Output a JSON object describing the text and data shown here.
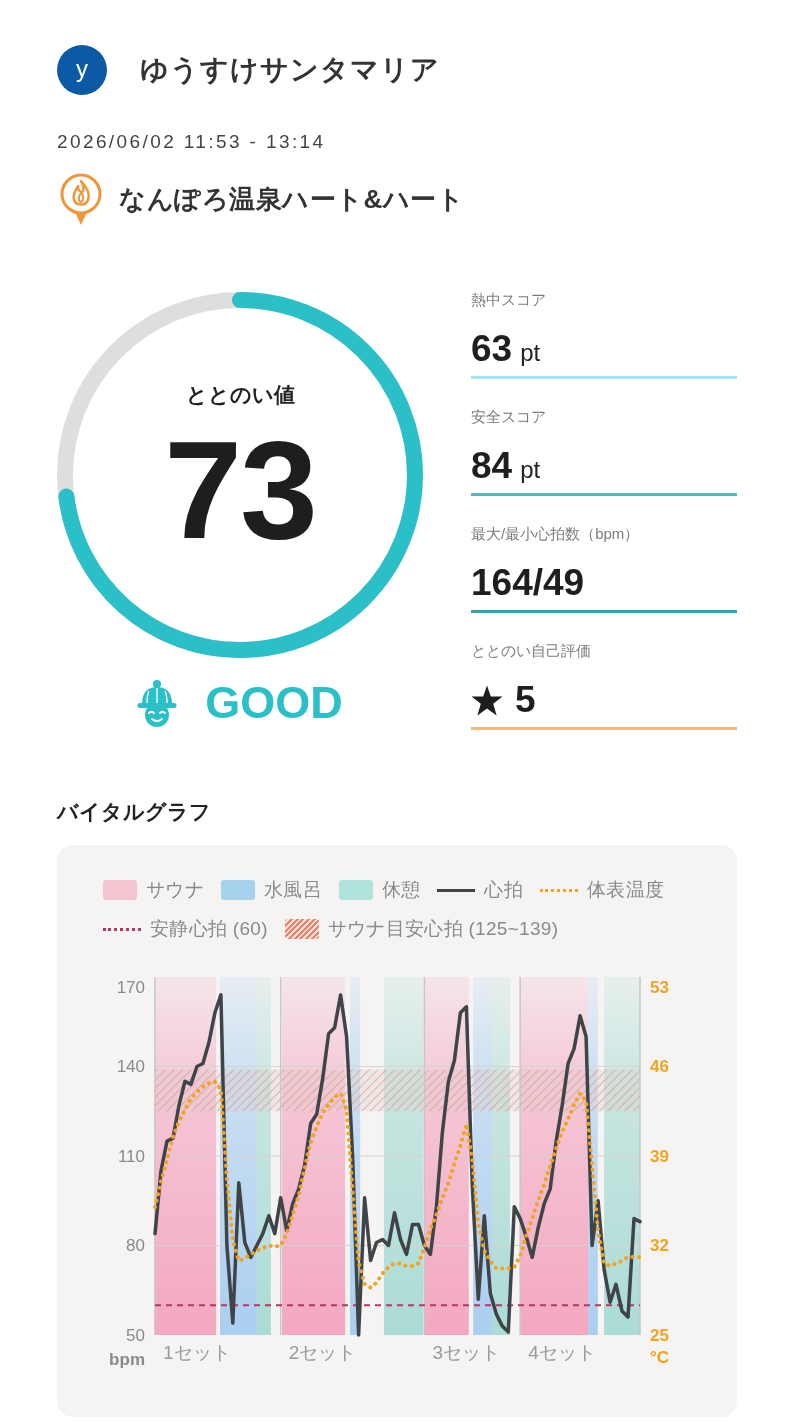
{
  "user": {
    "initial": "y",
    "name": "ゆうすけサンタマリア"
  },
  "session": {
    "datetime": "2026/06/02 11:53 - 13:14",
    "facility": "なんぽろ温泉ハート&ハート"
  },
  "score": {
    "label": "ととのい値",
    "value": "73",
    "level": 0.73,
    "rating": "GOOD"
  },
  "metrics": [
    {
      "kind": "value",
      "label": "熱中スコア",
      "value": "63",
      "unit": "pt",
      "color": "#a9e7f0"
    },
    {
      "kind": "value",
      "label": "安全スコア",
      "value": "84",
      "unit": "pt",
      "color": "#52b9c8"
    },
    {
      "kind": "value",
      "label": "最大/最小心拍数（bpm）",
      "value": "164/49",
      "color": "#3c9da6"
    },
    {
      "kind": "rating",
      "label": "ととのい自己評価",
      "value": "5",
      "color": "#f6b77c"
    }
  ],
  "vitals": {
    "title": "バイタルグラフ",
    "legend": [
      {
        "kind": "swatch",
        "label": "サウナ",
        "color": "#f4c6cf"
      },
      {
        "kind": "swatch",
        "label": "水風呂",
        "color": "#a6d2ee"
      },
      {
        "kind": "swatch",
        "label": "休憩",
        "color": "#b0e3dc"
      },
      {
        "kind": "line",
        "label": "心拍",
        "color": "#3f4448"
      },
      {
        "kind": "dotted",
        "label": "体表温度",
        "color": "#f2a31f"
      },
      {
        "kind": "dotted",
        "label": "安静心拍 (60)",
        "color": "#b13a63"
      },
      {
        "kind": "hatch",
        "label": "サウナ目安心拍 (125~139)",
        "color": "#e8846e"
      }
    ],
    "chart_data": {
      "type": "line",
      "ylabel": "bpm",
      "ylim": [
        50,
        170
      ],
      "yticks": [
        50,
        80,
        110,
        140,
        170
      ],
      "y2label": "°C",
      "y2lim": [
        25,
        53
      ],
      "y2ticks": [
        25,
        32,
        39,
        46,
        53
      ],
      "grid": true,
      "categories": [
        null,
        null,
        null,
        null,
        null,
        null,
        null,
        "1セット",
        null,
        null,
        null,
        null,
        null,
        null,
        null,
        null,
        null,
        null,
        null,
        null,
        null,
        null,
        null,
        null,
        null,
        null,
        null,
        null,
        "2セット",
        null,
        null,
        null,
        null,
        null,
        null,
        null,
        null,
        null,
        null,
        null,
        null,
        null,
        null,
        null,
        null,
        null,
        null,
        null,
        null,
        null,
        null,
        null,
        "3セット",
        null,
        null,
        null,
        null,
        null,
        null,
        null,
        null,
        null,
        null,
        null,
        null,
        null,
        null,
        null,
        "4セット",
        null,
        null,
        null,
        null,
        null,
        null,
        null,
        null,
        null,
        null,
        null,
        null,
        null
      ],
      "series": [
        {
          "color": "#3f4448",
          "values": [
            84,
            105,
            115,
            116,
            127,
            135,
            134,
            140,
            141,
            148,
            158,
            164,
            80,
            54,
            101,
            81,
            76,
            80,
            84,
            90,
            84,
            96,
            85,
            94,
            99,
            107,
            121,
            124,
            136,
            151,
            153,
            164,
            150,
            110,
            50,
            96,
            75,
            81,
            82,
            80,
            91,
            82,
            77,
            87,
            87,
            80,
            77,
            93,
            118,
            135,
            142,
            158,
            160,
            100,
            62,
            90,
            64,
            57,
            53,
            51,
            93,
            89,
            83,
            76,
            86,
            94,
            99,
            115,
            127,
            141,
            146,
            157,
            150,
            80,
            95,
            72,
            61,
            67,
            58,
            56,
            89,
            88
          ]
        },
        {
          "axis": "y2",
          "line_style": "dotted",
          "color": "#f2a31f",
          "values": [
            35.0,
            37.0,
            38.7,
            40.5,
            41.7,
            42.6,
            43.5,
            44.0,
            44.4,
            44.7,
            44.8,
            44.2,
            37.2,
            32.4,
            30.8,
            31.0,
            31.3,
            31.6,
            31.8,
            32.0,
            31.9,
            32.0,
            32.9,
            34.4,
            35.9,
            38.1,
            40.1,
            41.3,
            42.4,
            43.0,
            43.6,
            43.9,
            42.6,
            36.4,
            30.7,
            29.0,
            28.7,
            29.1,
            29.8,
            30.3,
            30.6,
            30.6,
            30.4,
            30.4,
            30.6,
            31.8,
            33.3,
            34.4,
            35.7,
            36.9,
            38.4,
            39.8,
            41.5,
            38.7,
            33.7,
            31.6,
            30.8,
            30.2,
            30.2,
            30.2,
            30.3,
            31.2,
            32.7,
            34.1,
            35.5,
            36.8,
            38.2,
            39.6,
            40.9,
            41.9,
            43.0,
            43.9,
            43.3,
            38.3,
            33.1,
            30.6,
            30.4,
            30.6,
            30.8,
            31.1,
            31.1,
            31.1
          ]
        }
      ],
      "bands": [
        {
          "axis": "y",
          "from": 125,
          "to": 139,
          "color": "#e8846e"
        }
      ],
      "ref_lines": [
        {
          "axis": "y",
          "value": 60,
          "line_style": "dashed",
          "color": "#b13a63"
        }
      ]
    }
  }
}
